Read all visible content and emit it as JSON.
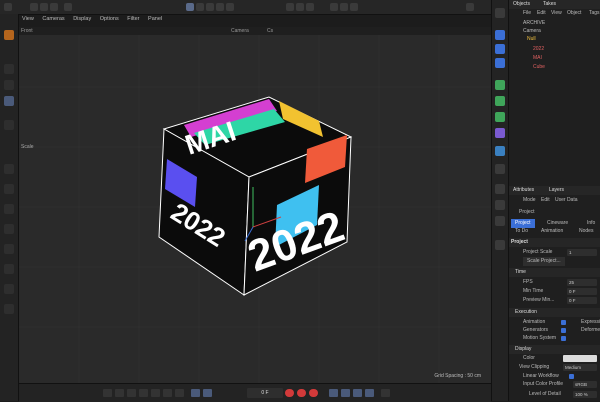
{
  "top_menu": [
    "View",
    "Cameras",
    "Display",
    "Options",
    "Filter",
    "Panel"
  ],
  "viewport": {
    "left_label": "Front",
    "camera_label": "Camera",
    "camera_value": "Cs",
    "side_label": "Scale",
    "grid_spacing": "Grid Spacing : 50 cm",
    "cube_texts": [
      "MAI",
      "2022",
      "2022"
    ]
  },
  "timeline": {
    "frame_field": "0 F"
  },
  "objects_panel": {
    "tabs": [
      "Objects",
      "Takes"
    ],
    "menu": [
      "File",
      "Edit",
      "View",
      "Object",
      "Tags"
    ],
    "items": [
      "ARCHIVE",
      "Camera",
      "Null",
      "2022",
      "MAI",
      "Cube"
    ]
  },
  "attributes_panel": {
    "tabs": [
      "Attributes",
      "Layers"
    ],
    "menu": [
      "Mode",
      "Edit",
      "User Data"
    ],
    "header": "Project",
    "subtabs": [
      "Project",
      "Cineware",
      "Info"
    ],
    "subtabs2": [
      "To Do",
      "Animation",
      "Nodes"
    ],
    "section_title": "Project",
    "project_scale_label": "Project Scale",
    "project_scale_value": "1",
    "scale_project_button": "Scale Project...",
    "time_section": "Time",
    "fps_label": "FPS",
    "fps_value": "25",
    "min_time_label": "Min Time",
    "min_time_value": "0 F",
    "preview_min_label": "Preview Min...",
    "preview_min_value": "0 F",
    "execution_section": "Execution",
    "animation_label": "Animation",
    "expressions_label": "Expressi...",
    "generators_label": "Generators",
    "deformers_label": "Deforme...",
    "motion_system_label": "Motion System",
    "display_section": "Display",
    "color_label": "Color",
    "view_clipping_label": "View Clipping",
    "view_clipping_value": "Medium",
    "linear_workflow_label": "Linear Workflow",
    "input_color_label": "Input Color Profile",
    "input_color_value": "sRGB",
    "lod_label": "Level of Detail",
    "lod_value": "100 %"
  },
  "colors": {
    "accent": "#3b6fd6",
    "record": "#d23a3a",
    "cube_dark": "#0b0b0b"
  }
}
